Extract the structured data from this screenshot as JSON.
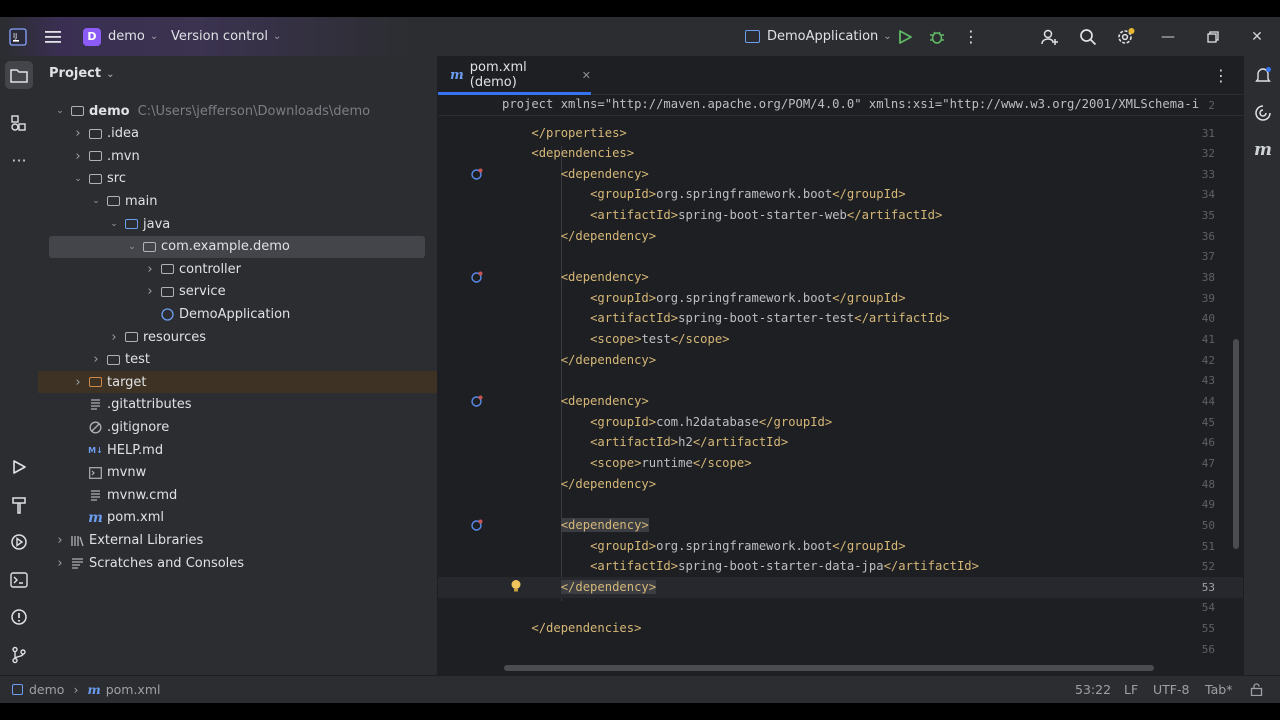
{
  "titlebar": {
    "project_badge": "D",
    "project_name": "demo",
    "vcs_label": "Version control",
    "run_config": "DemoApplication"
  },
  "left_strip_icons": [
    "folder-icon",
    "structure-icon",
    "more-icon",
    "run-icon",
    "build-icon",
    "services-icon",
    "terminal-icon",
    "problems-icon",
    "git-icon"
  ],
  "project_panel": {
    "title": "Project",
    "tree": [
      {
        "label": "demo",
        "path": "C:\\Users\\jefferson\\Downloads\\demo",
        "depth": 0,
        "open": true,
        "icon": "module-folder-icon"
      },
      {
        "label": ".idea",
        "depth": 1,
        "open": false,
        "icon": "folder-icon"
      },
      {
        "label": ".mvn",
        "depth": 1,
        "open": false,
        "icon": "folder-icon"
      },
      {
        "label": "src",
        "depth": 1,
        "open": true,
        "icon": "folder-icon"
      },
      {
        "label": "main",
        "depth": 2,
        "open": true,
        "icon": "folder-icon"
      },
      {
        "label": "java",
        "depth": 3,
        "open": true,
        "icon": "source-folder-icon"
      },
      {
        "label": "com.example.demo",
        "depth": 4,
        "open": true,
        "icon": "package-icon",
        "selected": true
      },
      {
        "label": "controller",
        "depth": 5,
        "open": false,
        "icon": "package-icon"
      },
      {
        "label": "service",
        "depth": 5,
        "open": false,
        "icon": "package-icon"
      },
      {
        "label": "DemoApplication",
        "depth": 5,
        "icon": "spring-class-icon"
      },
      {
        "label": "resources",
        "depth": 3,
        "open": false,
        "icon": "resources-folder-icon"
      },
      {
        "label": "test",
        "depth": 2,
        "open": false,
        "icon": "folder-icon"
      },
      {
        "label": "target",
        "depth": 1,
        "open": false,
        "icon": "excluded-folder-icon",
        "target": true
      },
      {
        "label": ".gitattributes",
        "depth": 1,
        "icon": "text-file-icon"
      },
      {
        "label": ".gitignore",
        "depth": 1,
        "icon": "ignore-file-icon"
      },
      {
        "label": "HELP.md",
        "depth": 1,
        "icon": "markdown-icon"
      },
      {
        "label": "mvnw",
        "depth": 1,
        "icon": "shell-file-icon"
      },
      {
        "label": "mvnw.cmd",
        "depth": 1,
        "icon": "text-file-icon"
      },
      {
        "label": "pom.xml",
        "depth": 1,
        "icon": "maven-icon"
      },
      {
        "label": "External Libraries",
        "depth": 0,
        "open": false,
        "icon": "libraries-icon"
      },
      {
        "label": "Scratches and Consoles",
        "depth": 0,
        "open": false,
        "icon": "scratches-icon"
      }
    ]
  },
  "editor": {
    "tab_label": "pom.xml (demo)",
    "sticky_line_number": "2",
    "sticky_line": "<project xmlns=\"http://maven.apache.org/POM/4.0.0\" xmlns:xsi=\"http://www.w3.org/2001/XMLSchema-i",
    "lines": [
      {
        "n": "31",
        "text": "    </properties>"
      },
      {
        "n": "32",
        "text": "    <dependencies>"
      },
      {
        "n": "33",
        "text": "        <dependency>",
        "gutter": true
      },
      {
        "n": "34",
        "text": "            <groupId>org.springframework.boot</groupId>"
      },
      {
        "n": "35",
        "text": "            <artifactId>spring-boot-starter-web</artifactId>"
      },
      {
        "n": "36",
        "text": "        </dependency>"
      },
      {
        "n": "37",
        "text": ""
      },
      {
        "n": "38",
        "text": "        <dependency>",
        "gutter": true
      },
      {
        "n": "39",
        "text": "            <groupId>org.springframework.boot</groupId>"
      },
      {
        "n": "40",
        "text": "            <artifactId>spring-boot-starter-test</artifactId>"
      },
      {
        "n": "41",
        "text": "            <scope>test</scope>"
      },
      {
        "n": "42",
        "text": "        </dependency>"
      },
      {
        "n": "43",
        "text": ""
      },
      {
        "n": "44",
        "text": "        <dependency>",
        "gutter": true
      },
      {
        "n": "45",
        "text": "            <groupId>com.h2database</groupId>"
      },
      {
        "n": "46",
        "text": "            <artifactId>h2</artifactId>"
      },
      {
        "n": "47",
        "text": "            <scope>runtime</scope>"
      },
      {
        "n": "48",
        "text": "        </dependency>"
      },
      {
        "n": "49",
        "text": ""
      },
      {
        "n": "50",
        "text": "        <dependency>",
        "gutter": true,
        "highlight": true
      },
      {
        "n": "51",
        "text": "            <groupId>org.springframework.boot</groupId>"
      },
      {
        "n": "52",
        "text": "            <artifactId>spring-boot-starter-data-jpa</artifactId>"
      },
      {
        "n": "53",
        "text": "        </dependency>",
        "current": true,
        "bulb": true,
        "highlight": true
      },
      {
        "n": "54",
        "text": ""
      },
      {
        "n": "55",
        "text": "    </dependencies>"
      },
      {
        "n": "56",
        "text": ""
      }
    ]
  },
  "right_strip_icons": [
    "notifications-icon",
    "ai-assistant-icon",
    "maven-tool-icon"
  ],
  "statusbar": {
    "breadcrumb_project": "demo",
    "breadcrumb_file": "pom.xml",
    "caret": "53:22",
    "line_sep": "LF",
    "encoding": "UTF-8",
    "indent": "Tab*"
  }
}
